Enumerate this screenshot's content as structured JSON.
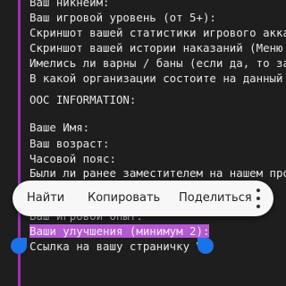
{
  "document": {
    "lines": [
      "Ваш никнейм:",
      "Ваш игровой уровень (от 5+):",
      "Скриншот вашей статистики игрового аккаунта",
      "Скриншот вашей истории наказаний (Меню",
      "Имелись ли варны / баны (если да, то за",
      "В какой организации состоите на данный",
      "",
      "OOC INFORMATION:",
      "",
      "Ваше Имя:",
      "Ваш возраст:",
      "Часовой пояс:",
      "Были ли ранее заместителем на нашем про",
      "",
      "Ваш игровой опыт:",
      "Ваши улучшения (минимум 2):",
      "Ссылка на вашу страничку VK"
    ]
  },
  "selection_menu": {
    "find": "Найти",
    "copy": "Копировать",
    "share": "Поделиться"
  },
  "colors": {
    "background": "#1e1e1e",
    "text": "#e6e6e6",
    "selection": "#b45ad0",
    "accent_rule": "#9c2fb0",
    "handles": "#1a73e8"
  }
}
